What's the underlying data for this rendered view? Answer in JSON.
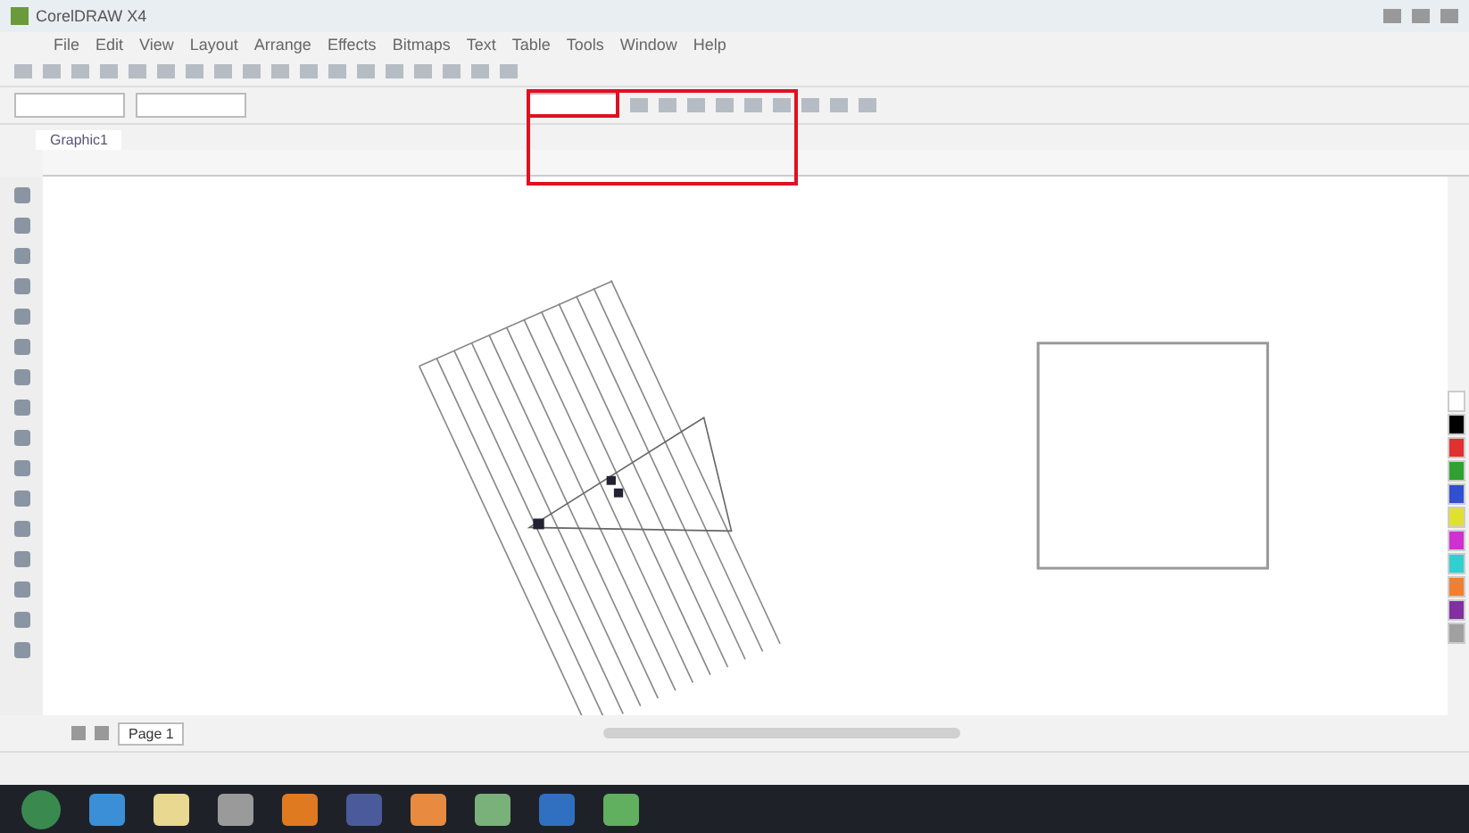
{
  "window": {
    "title": "CorelDRAW X4"
  },
  "menu": [
    "File",
    "Edit",
    "View",
    "Layout",
    "Arrange",
    "Effects",
    "Bitmaps",
    "Text",
    "Table",
    "Tools",
    "Window",
    "Help"
  ],
  "document_tab": {
    "label": "Graphic1"
  },
  "page_tabs": [
    {
      "label": "Page 1",
      "selected": true
    }
  ],
  "taskbar": {
    "apps": [
      {
        "color": "#3a8fd6"
      },
      {
        "color": "#e8d890"
      },
      {
        "color": "#9a9a9a"
      },
      {
        "color": "#e07a20"
      },
      {
        "color": "#4a5a9a"
      },
      {
        "color": "#e88a40"
      },
      {
        "color": "#7ab07a"
      },
      {
        "color": "#3070c0"
      },
      {
        "color": "#60b060"
      }
    ]
  }
}
